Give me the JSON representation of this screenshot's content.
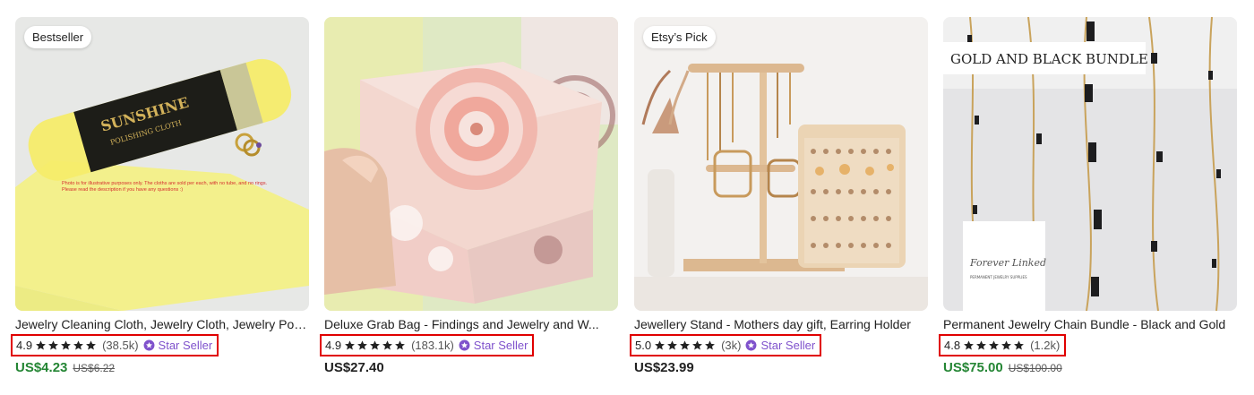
{
  "colors": {
    "sale_price": "#258635",
    "star_seller": "#7f52cc",
    "highlight_box": "#e00000",
    "star_fill": "#222222"
  },
  "icons": {
    "rating_star": "star-icon",
    "star_seller": "star-seller-badge-icon"
  },
  "listings": [
    {
      "badge": "Bestseller",
      "image_text": {
        "brand": "SUNSHINE",
        "product": "POLISHING CLOTH",
        "note": "Photo is for illustrative purposes only. The cloths are sold per each, with no tube, and no rings. Please read the description if you have any questions :)"
      },
      "title": "Jewelry Cleaning Cloth, Jewelry Cloth, Jewelry Polishing Cloth",
      "rating": "4.9",
      "stars": 5,
      "reviews": "(38.5k)",
      "star_seller": "Star Seller",
      "price": "US$4.23",
      "original_price": "US$6.22"
    },
    {
      "badge": "",
      "title": "Deluxe Grab Bag - Findings and Jewelry and W...",
      "rating": "4.9",
      "stars": 5,
      "reviews": "(183.1k)",
      "star_seller": "Star Seller",
      "price": "US$27.40",
      "original_price": ""
    },
    {
      "badge": "Etsy’s Pick",
      "title": "Jewellery Stand - Mothers day gift, Earring Holder",
      "rating": "5.0",
      "stars": 5,
      "reviews": "(3k)",
      "star_seller": "Star Seller",
      "price": "US$23.99",
      "original_price": ""
    },
    {
      "badge": "",
      "image_text": {
        "heading": "GOLD AND BLACK BUNDLE",
        "logo_script": "Forever Linked",
        "logo_sub": "PERMANENT JEWELRY SUPPLIES"
      },
      "title": "Permanent Jewelry Chain Bundle - Black and Gold",
      "rating": "4.8",
      "stars": 5,
      "reviews": "(1.2k)",
      "star_seller": "",
      "price": "US$75.00",
      "original_price": "US$100.00"
    }
  ]
}
